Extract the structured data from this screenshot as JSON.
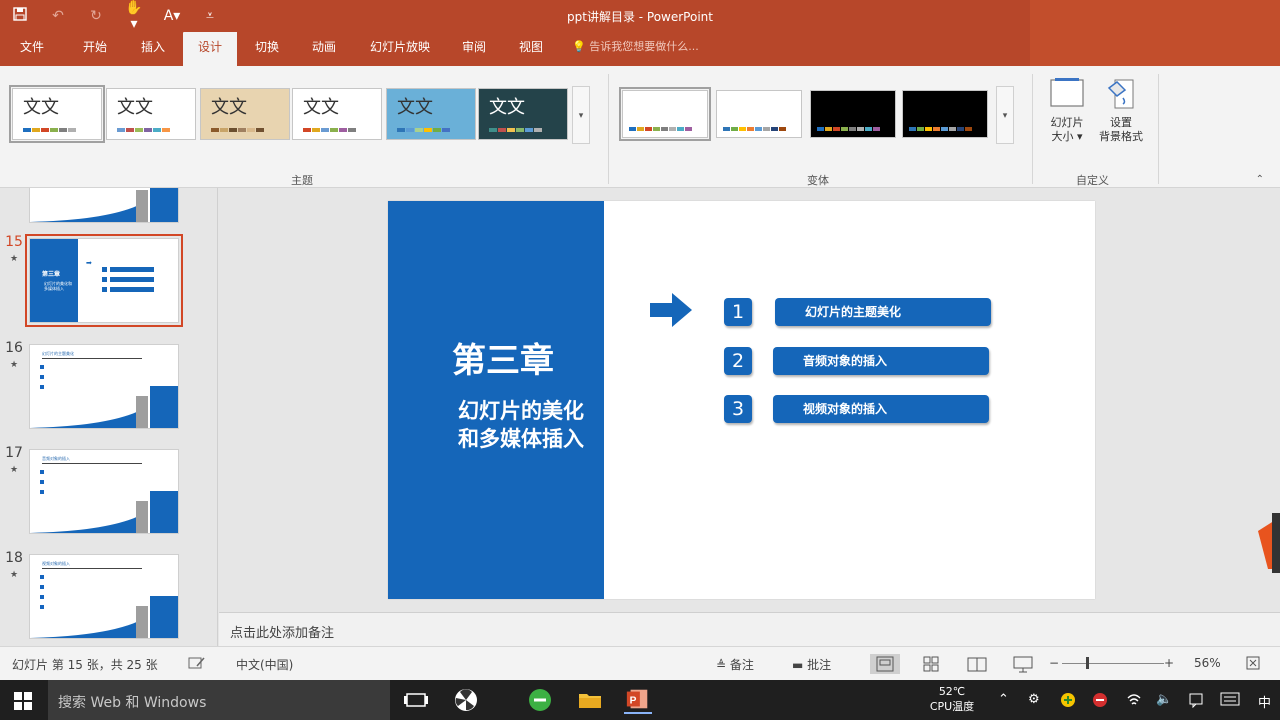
{
  "window": {
    "title": "ppt讲解目录 - PowerPoint",
    "qat_icons": [
      "save-icon",
      "undo-icon",
      "redo-icon",
      "touch-mode-icon",
      "format-icon",
      "customize-qat-icon"
    ]
  },
  "tabs": [
    "文件",
    "开始",
    "插入",
    "设计",
    "切换",
    "动画",
    "幻灯片放映",
    "审阅",
    "视图"
  ],
  "active_tab": "设计",
  "tell_me": "告诉我您想要做什么...",
  "ribbon": {
    "themes": [
      {
        "label": "文文",
        "bg": "#ffffff",
        "bars": [
          "#1f6fbf",
          "#e0a81f",
          "#d24726",
          "#8ab04d",
          "#7f7f7f",
          "#b0b0b0"
        ]
      },
      {
        "label": "文文",
        "bg": "#ffffff",
        "bars": [
          "#6a9bd2",
          "#c0504d",
          "#9bbb59",
          "#8064a2",
          "#4bacc6",
          "#f79646"
        ]
      },
      {
        "label": "文文",
        "bg": "#e8d4b0",
        "bars": [
          "#8b5a2b",
          "#c8a468",
          "#6b4f2f",
          "#a08060",
          "#d9b98c",
          "#705030"
        ]
      },
      {
        "label": "文文",
        "bg": "#ffffff",
        "bars": [
          "#d24726",
          "#e0a81f",
          "#6a9bd2",
          "#8ab04d",
          "#9e5ea0",
          "#7f7f7f"
        ]
      },
      {
        "label": "文文",
        "bg": "#6ab0d8",
        "bars": [
          "#2e75b6",
          "#5b9bd5",
          "#a9d18e",
          "#ffc000",
          "#70ad47",
          "#4472c4"
        ]
      },
      {
        "label": "文文",
        "bg": "#24434a",
        "bars": [
          "#3f8f8a",
          "#c0504d",
          "#f2c14e",
          "#86b86a",
          "#5b9bd5",
          "#b0b0b0"
        ]
      }
    ],
    "variants": [
      {
        "bg": "#ffffff",
        "bars": [
          "#1f6fbf",
          "#e0a81f",
          "#d24726",
          "#8ab04d",
          "#7f7f7f",
          "#b0b0b0",
          "#4bacc6",
          "#9e5ea0"
        ]
      },
      {
        "bg": "#ffffff",
        "bars": [
          "#2e75b6",
          "#70ad47",
          "#ffc000",
          "#ed7d31",
          "#5b9bd5",
          "#a5a5a5",
          "#264478",
          "#9e480e"
        ]
      },
      {
        "bg": "#000000",
        "bars": [
          "#1f6fbf",
          "#e0a81f",
          "#d24726",
          "#8ab04d",
          "#7f7f7f",
          "#b0b0b0",
          "#4bacc6",
          "#9e5ea0"
        ]
      },
      {
        "bg": "#000000",
        "bars": [
          "#2e75b6",
          "#70ad47",
          "#ffc000",
          "#ed7d31",
          "#5b9bd5",
          "#a5a5a5",
          "#264478",
          "#9e480e"
        ]
      }
    ],
    "groups": {
      "themes": "主题",
      "variants": "变体",
      "customize": "自定义"
    },
    "slide_size": {
      "line1": "幻灯片",
      "line2": "大小 ▾"
    },
    "format_bg": {
      "line1": "设置",
      "line2": "背景格式"
    }
  },
  "thumbnails": [
    {
      "num": "15",
      "star": "★",
      "selected": true,
      "title": "第三章",
      "sub": "幻灯片的美化和多媒体插入"
    },
    {
      "num": "16",
      "star": "★",
      "selected": false,
      "head": "幻灯片的主题美化"
    },
    {
      "num": "17",
      "star": "★",
      "selected": false,
      "head": "音频对象的插入"
    },
    {
      "num": "18",
      "star": "★",
      "selected": false,
      "head": "视频对象的插入"
    }
  ],
  "slide": {
    "chapter": "第三章",
    "subtitle": "幻灯片的美化和多媒体插入",
    "items": [
      {
        "num": "1",
        "label": "幻灯片的主题美化"
      },
      {
        "num": "2",
        "label": "音频对象的插入"
      },
      {
        "num": "3",
        "label": "视频对象的插入"
      }
    ],
    "accent": "#1566b9"
  },
  "notes_placeholder": "点击此处添加备注",
  "status": {
    "slide_info": "幻灯片 第 15 张，共 25 张",
    "language": "中文(中国)",
    "notes": "备注",
    "comments": "批注",
    "zoom": "56%"
  },
  "taskbar": {
    "search_placeholder": "搜索 Web 和 Windows",
    "cpu_temp": "52℃",
    "cpu_label": "CPU温度",
    "ime": "中"
  }
}
